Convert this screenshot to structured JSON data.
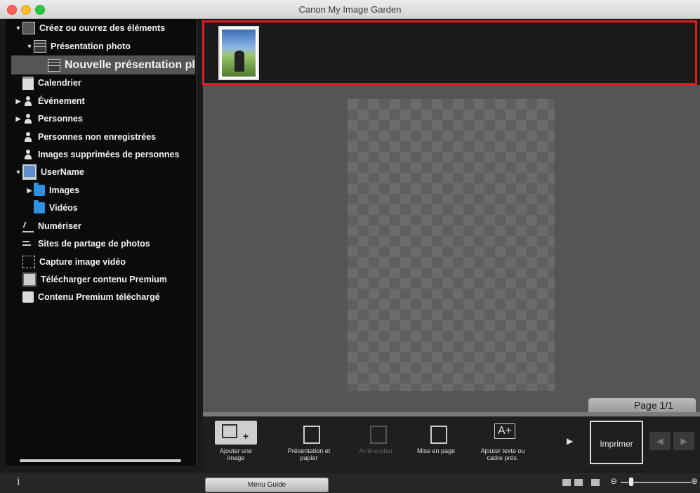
{
  "window": {
    "title": "Canon My Image Garden"
  },
  "sidebar": {
    "items": [
      {
        "label": "Créez ou ouvrez des éléments",
        "icon": "create-icon",
        "expanded": true
      },
      {
        "label": "Présentation photo",
        "icon": "layout-icon",
        "expanded": true
      },
      {
        "label": "Nouvelle présentation pl",
        "icon": "layout-icon",
        "selected": true
      },
      {
        "label": "Calendrier",
        "icon": "calendar-icon"
      },
      {
        "label": "Événement",
        "icon": "event-icon",
        "expanded": false
      },
      {
        "label": "Personnes",
        "icon": "person-icon",
        "expanded": false
      },
      {
        "label": "Personnes non enregistrées",
        "icon": "unregistered-person-icon"
      },
      {
        "label": "Images supprimées de personnes",
        "icon": "deleted-person-icon"
      },
      {
        "label": "UserName",
        "icon": "computer-icon",
        "expanded": true
      },
      {
        "label": "Images",
        "icon": "folder-icon",
        "expanded": false
      },
      {
        "label": "Vidéos",
        "icon": "folder-icon"
      },
      {
        "label": "Numériser",
        "icon": "scan-icon"
      },
      {
        "label": "Sites de partage de photos",
        "icon": "photo-share-icon"
      },
      {
        "label": "Capture image vidéo",
        "icon": "video-capture-icon"
      },
      {
        "label": "Télécharger contenu Premium",
        "icon": "download-icon"
      },
      {
        "label": "Contenu Premium téléchargé",
        "icon": "downloaded-folder-icon"
      }
    ]
  },
  "editor": {
    "page_label": "Page 1/1"
  },
  "toolbar": {
    "add_image": "Ajouter une image",
    "layout_paper": "Présentation et papier",
    "background": "Arrière-plan",
    "layout": "Mise en page",
    "add_text": "Ajouter texte ou cadre prés.",
    "print": "Imprimer",
    "more": "▶",
    "prev": "◀",
    "next": "▶"
  },
  "statusbar": {
    "info": "i",
    "menu_guide": "Menu Guide",
    "zoom_out": "⊖",
    "zoom_in": "⊕"
  },
  "colors": {
    "highlight_border": "#e41a1a",
    "selected_row": "#555555"
  }
}
